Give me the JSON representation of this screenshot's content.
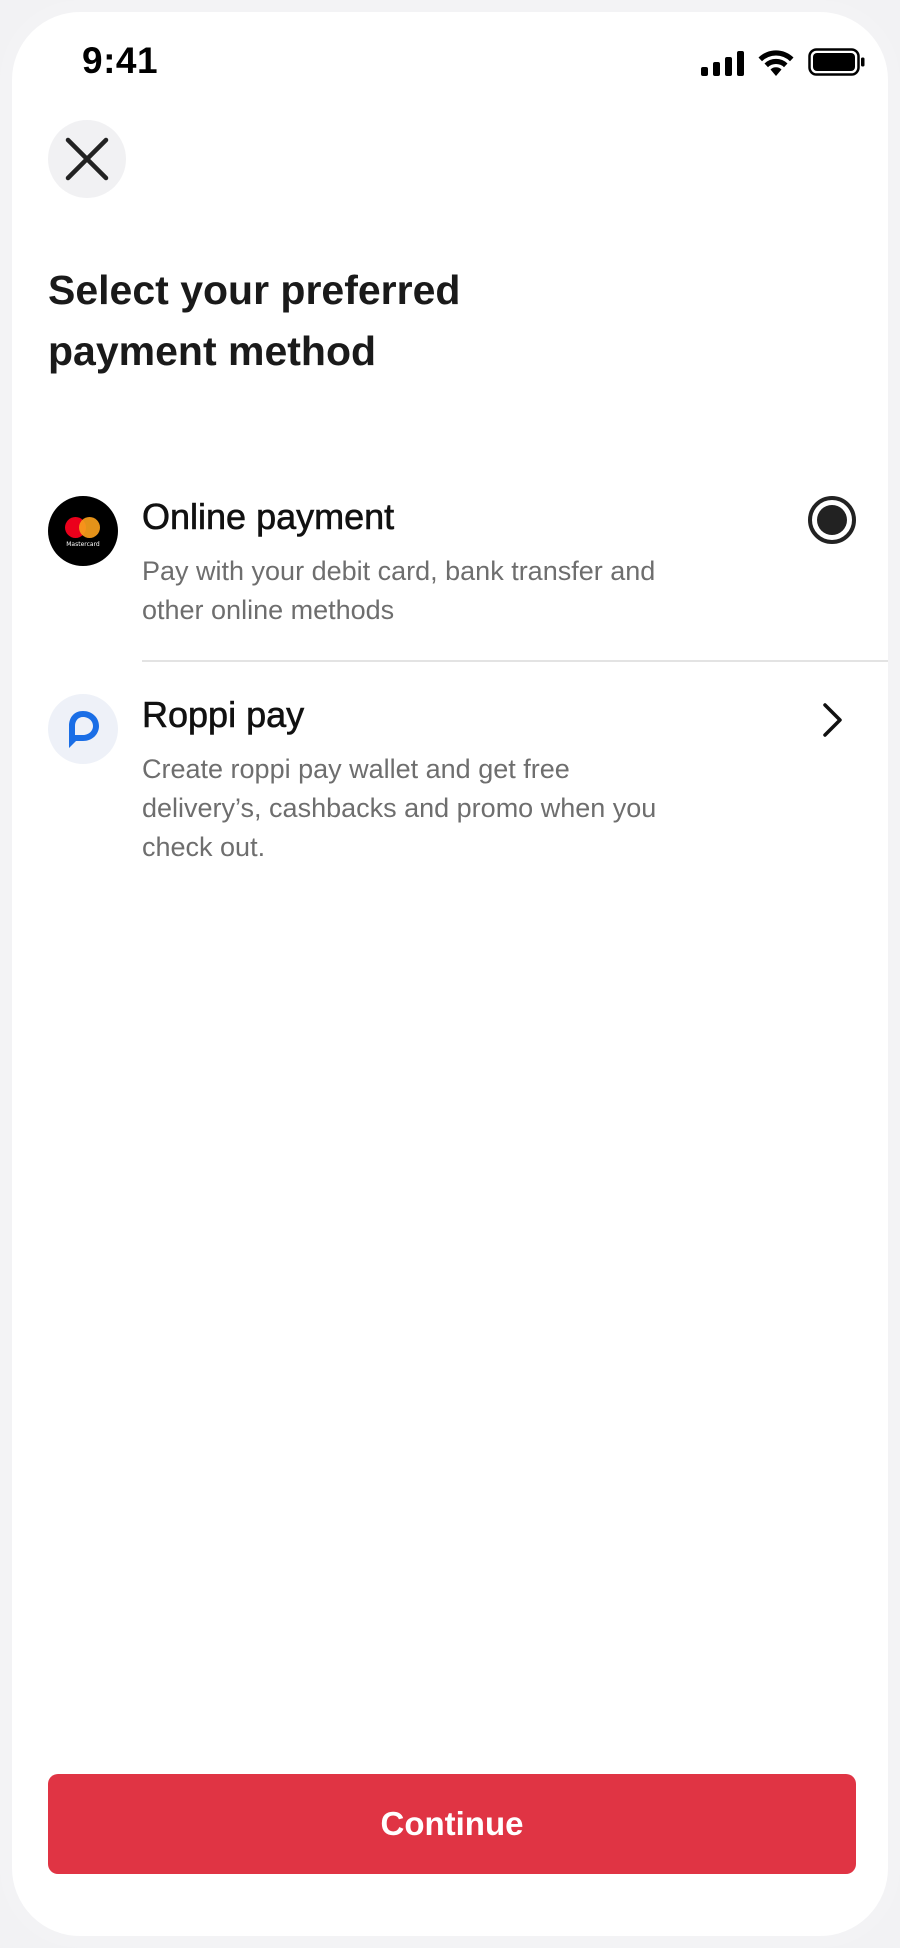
{
  "status_bar": {
    "time": "9:41",
    "icons": [
      "signal-icon",
      "wifi-icon",
      "battery-icon"
    ]
  },
  "header": {
    "close_icon": "close-icon"
  },
  "title": "Select your preferred payment method",
  "options": [
    {
      "icon": "mastercard-icon",
      "icon_text": "Mastercard",
      "title": "Online payment",
      "description": "Pay with your debit card, bank transfer and other online methods",
      "selected": true,
      "control": "radio"
    },
    {
      "icon": "roppi-pay-icon",
      "title": "Roppi pay",
      "description": "Create roppi pay wallet and get free delivery’s, cashbacks and promo when you check out.",
      "control": "chevron-right-icon"
    }
  ],
  "footer": {
    "continue_label": "Continue"
  },
  "colors": {
    "accent": "#e03444",
    "roppi_blue": "#1a6ee6",
    "text_primary": "#111111",
    "text_secondary": "#6e6e6e"
  }
}
